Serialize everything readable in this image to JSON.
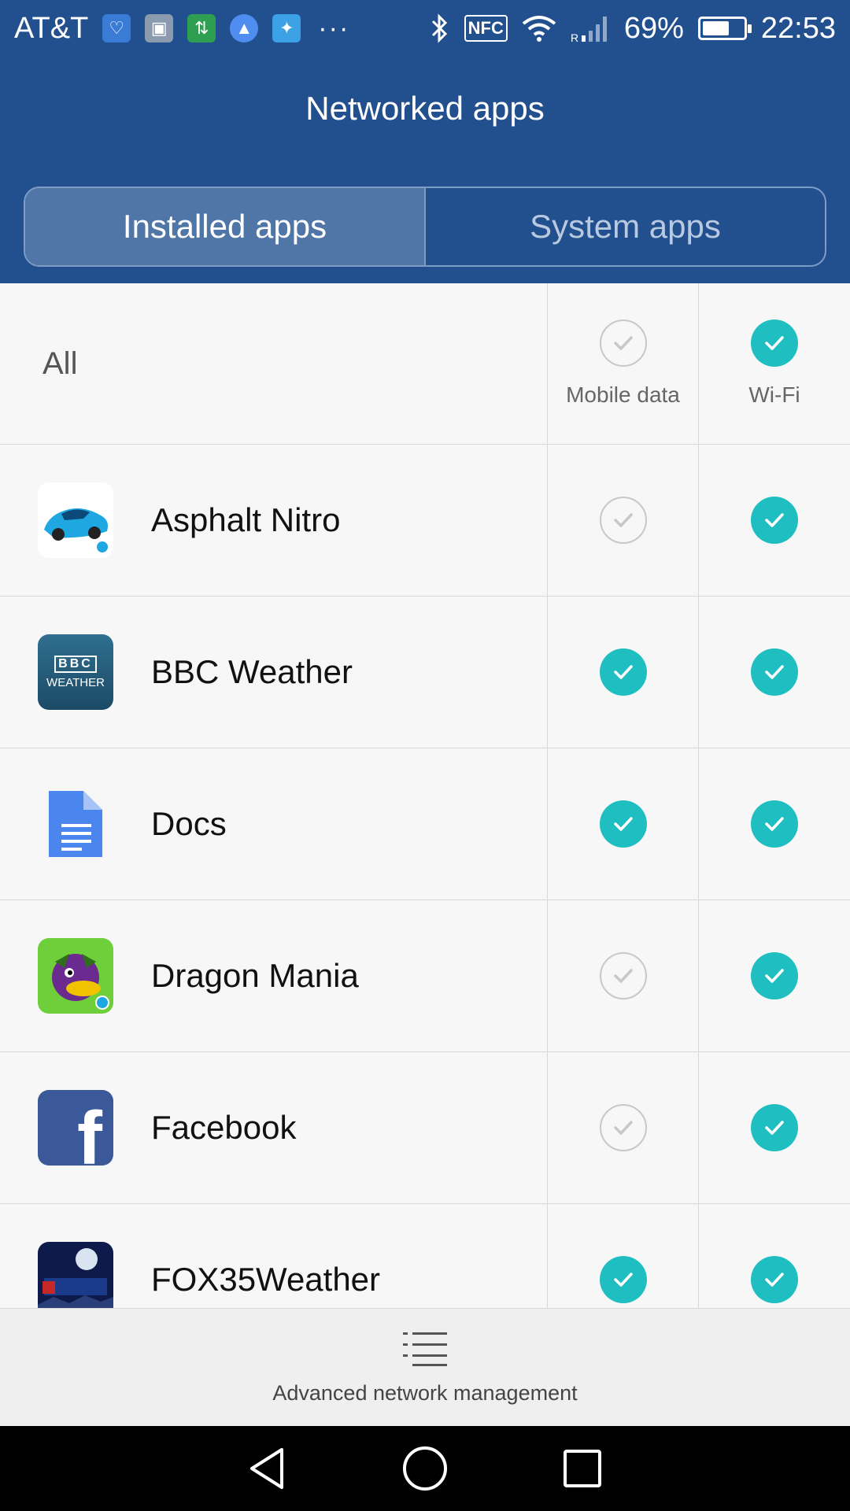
{
  "status": {
    "carrier": "AT&T",
    "battery": "69%",
    "battery_level": 0.69,
    "time": "22:53",
    "nfc": "NFC",
    "more": "···"
  },
  "header": {
    "title": "Networked apps",
    "tabs": [
      {
        "label": "Installed apps",
        "active": true
      },
      {
        "label": "System apps",
        "active": false
      }
    ]
  },
  "table": {
    "all_label": "All",
    "columns": {
      "mobile": "Mobile data",
      "wifi": "Wi-Fi"
    },
    "all_mobile": false,
    "all_wifi": true,
    "apps": [
      {
        "name": "Asphalt Nitro",
        "icon": "asphalt-nitro-icon",
        "mobile": false,
        "wifi": true
      },
      {
        "name": "BBC Weather",
        "icon": "bbc-weather-icon",
        "icon_text_top": "BBC",
        "icon_text_bottom": "WEATHER",
        "mobile": true,
        "wifi": true
      },
      {
        "name": "Docs",
        "icon": "google-docs-icon",
        "mobile": true,
        "wifi": true
      },
      {
        "name": "Dragon Mania",
        "icon": "dragon-mania-icon",
        "mobile": false,
        "wifi": true
      },
      {
        "name": "Facebook",
        "icon": "facebook-icon",
        "icon_text": "f",
        "mobile": false,
        "wifi": true
      },
      {
        "name": "FOX35Weather",
        "icon": "fox35-weather-icon",
        "mobile": true,
        "wifi": true
      }
    ]
  },
  "bottom": {
    "label": "Advanced network management"
  },
  "colors": {
    "header_bg": "#22508f",
    "check_on": "#1fbfc1"
  }
}
